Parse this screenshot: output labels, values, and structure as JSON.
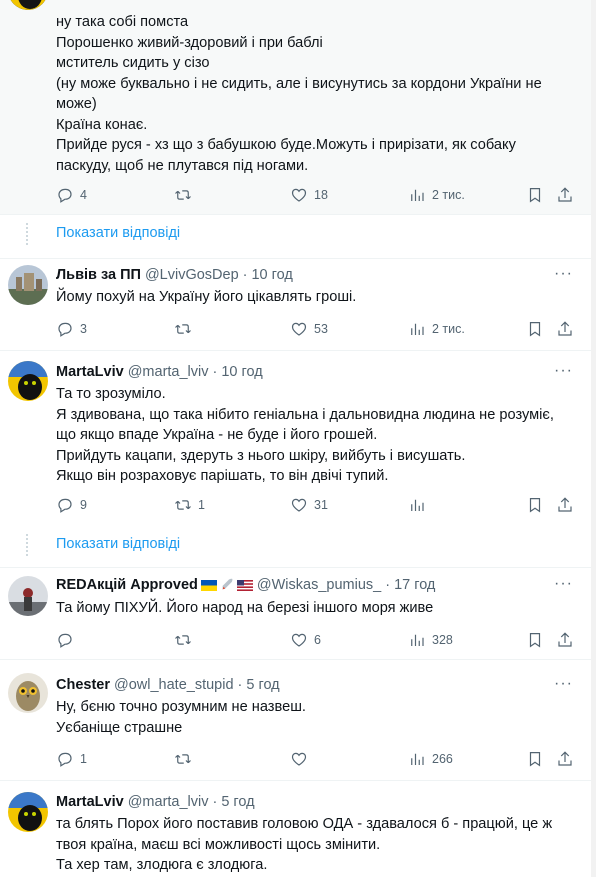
{
  "tweets": [
    {
      "id": "t0",
      "text": [
        "ну така собі помста",
        "Порошенко живий-здоровий і при баблі",
        "мститель сидить у сізо",
        "(ну може буквально і не сидить, але і висунутись за кордони України не",
        "може)",
        "Країна конає.",
        "Прийде руся - хз що з бабушкою буде.Можуть і прирізати, як собаку",
        "паскуду, щоб не плутався під ногами."
      ],
      "replies": "4",
      "retweets": "",
      "likes": "18",
      "views": "2 тис."
    },
    {
      "id": "t1",
      "name": "Львів за ПП",
      "handle": "@LvivGosDep",
      "dot": "·",
      "time": "10 год",
      "text": [
        "Йому похуй на Україну його цікавлять гроші."
      ],
      "replies": "3",
      "retweets": "",
      "likes": "53",
      "views": "2 тис."
    },
    {
      "id": "t2",
      "name": "MartaLviv",
      "handle": "@marta_lviv",
      "dot": "·",
      "time": "10 год",
      "text": [
        "Та то зрозуміло.",
        "Я здивована, що така нібито геніальна і дальновидна людина не розуміє,",
        "що якщо впаде Україна - не буде і його грошей.",
        "Прийдуть кацапи, здеруть з нього шкіру, вийбуть і висушать.",
        "Якщо він розраховує парішать, то він двічі тупий."
      ],
      "replies": "9",
      "retweets": "1",
      "likes": "31",
      "views": ""
    },
    {
      "id": "t3",
      "name": "REDАкцій Approved",
      "handle": "@Wiskas_pumius_",
      "dot": "·",
      "time": "17 год",
      "text": [
        "Та йому ПІХУЙ. Його народ на березі іншого моря живе"
      ],
      "replies": "",
      "retweets": "",
      "likes": "6",
      "views": "328"
    },
    {
      "id": "t4",
      "name": "Chester",
      "handle": "@owl_hate_stupid",
      "dot": "·",
      "time": "5 год",
      "text": [
        "Ну, бєню точно розумним не назвеш.",
        "Уєбаніще страшне"
      ],
      "replies": "1",
      "retweets": "",
      "likes": "",
      "views": "266"
    },
    {
      "id": "t5",
      "name": "MartaLviv",
      "handle": "@marta_lviv",
      "dot": "·",
      "time": "5 год",
      "text": [
        "та блять Порох його поставив головою ОДА - здавалося б - працюй, це ж",
        "твоя країна, маєш всі можливості щось змінити.",
        "Та хер там, злодюга є злодюга."
      ]
    }
  ],
  "show_replies_label": "Показати відповіді",
  "more_label": "···",
  "colors": {
    "accent": "#1d9bf0",
    "muted": "#536471",
    "text": "#0f1419",
    "border": "#eff3f4"
  },
  "icons": [
    "reply-icon",
    "retweet-icon",
    "like-icon",
    "views-icon",
    "bookmark-icon",
    "share-icon",
    "more-icon"
  ]
}
